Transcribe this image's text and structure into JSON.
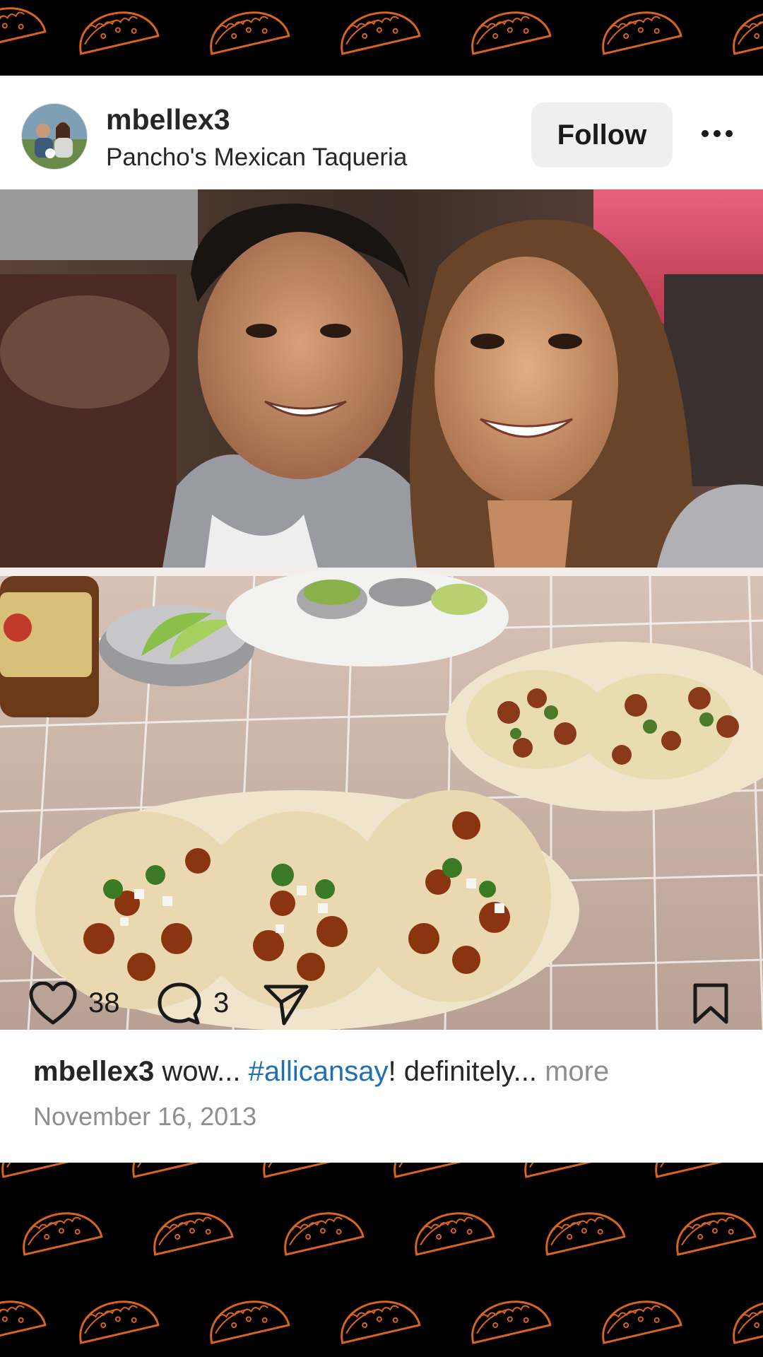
{
  "post": {
    "username": "mbellex3",
    "location": "Pancho's Mexican Taqueria",
    "follow_label": "Follow",
    "more_icon": "ellipsis-icon",
    "likes": "38",
    "comments": "3",
    "caption": {
      "username": "mbellex3",
      "text_before": " wow... ",
      "hashtag": "#allicansay",
      "text_after": "! definitely... ",
      "more_label": "more"
    },
    "date": "November 16, 2013"
  },
  "icons": {
    "like": "heart-icon",
    "comment": "comment-bubble-icon",
    "share": "send-icon",
    "save": "bookmark-icon"
  },
  "colors": {
    "background_pattern": "#000000",
    "pattern_stroke": "#d8641e",
    "hashtag": "#1f6fb5",
    "follow_button_bg": "#efefef",
    "muted_text": "#8e8e8e"
  }
}
